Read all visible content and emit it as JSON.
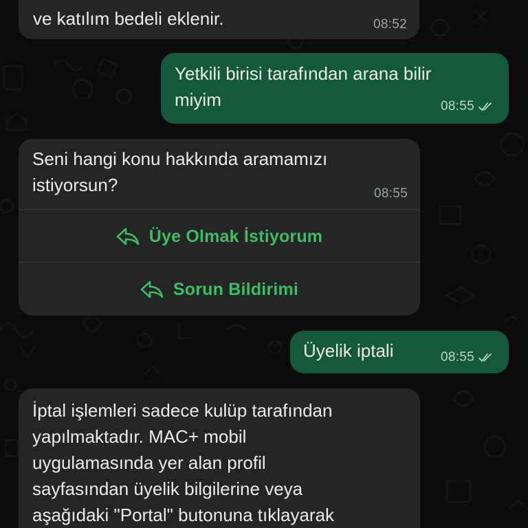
{
  "messages": [
    {
      "id": "m1",
      "direction": "incoming",
      "text": "ve katılım bedeli eklenir.",
      "time": "08:52"
    },
    {
      "id": "m2",
      "direction": "outgoing",
      "text": "Yetkili birisi tarafından arana bilir\nmiyim",
      "time": "08:55",
      "status": "read-ticks-icon"
    },
    {
      "id": "m3",
      "direction": "incoming",
      "text": "Seni hangi konu hakkında aramamızı\nistiyorsun?",
      "time": "08:55",
      "quick_replies": [
        {
          "label": "Üye Olmak İstiyorum",
          "icon": "reply-arrow-icon"
        },
        {
          "label": "Sorun Bildirimi",
          "icon": "reply-arrow-icon"
        }
      ]
    },
    {
      "id": "m4",
      "direction": "outgoing",
      "text": "Üyelik iptali",
      "time": "08:55",
      "status": "read-ticks-icon"
    },
    {
      "id": "m5",
      "direction": "incoming",
      "text": "İptal işlemleri sadece kulüp tarafından\nyapılmaktadır. MAC+ mobil\nuygulamasında yer alan profil\nsayfasından üyelik bilgilerine veya\naşağıdaki \"Portal\" butonuna tıklayarak"
    }
  ],
  "colors": {
    "background": "#0c0c0c",
    "incoming_bubble": "#242626",
    "outgoing_bubble": "#15593d",
    "quick_reply_accent": "#3fbd65",
    "timestamp": "#9ea3a1"
  }
}
